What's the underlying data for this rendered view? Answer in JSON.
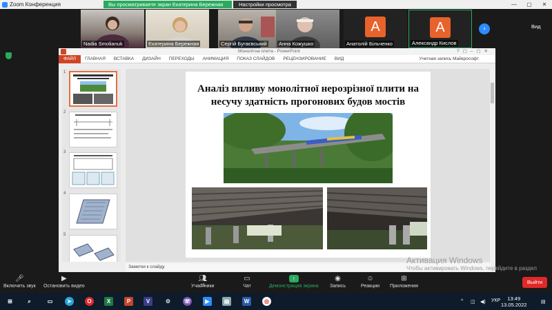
{
  "window": {
    "title": "Zoom Конференция"
  },
  "banner": {
    "sharing_text": "Вы просматриваете экран Екатерина Бережная",
    "view_options": "Настройки просмотра ⌄"
  },
  "participants": [
    {
      "name": "Nadia Smolianuk",
      "muted": true
    },
    {
      "name": "Екатерина Бережная",
      "muted": false
    },
    {
      "name": "Сергій Бугаєвський",
      "muted": true
    },
    {
      "name": "Анна Кожушко",
      "muted": true
    },
    {
      "name": "Анатолій Більченко",
      "muted": false,
      "initial": "A"
    },
    {
      "name": "Александр Кислов",
      "muted": false,
      "initial": "A"
    }
  ],
  "gallery": {
    "view_label": "Вид"
  },
  "powerpoint": {
    "doc_title": "Монолітна плита - PowerPoint",
    "account": "Учетная запись Майкрософт",
    "tabs": [
      "ФАЙЛ",
      "ГЛАВНАЯ",
      "ВСТАВКА",
      "ДИЗАЙН",
      "ПЕРЕХОДЫ",
      "АНИМАЦИЯ",
      "ПОКАЗ СЛАЙДОВ",
      "РЕЦЕНЗИРОВАНИЕ",
      "ВИД"
    ],
    "thumb_numbers": [
      "1",
      "2",
      "3",
      "4",
      "5"
    ],
    "slide_title": "Аналіз впливу монолітної нерозрізної плити на несучу здатність прогонових будов мостів",
    "notes_placeholder": "Заметки к слайду"
  },
  "watermark": {
    "line1": "Активация Windows",
    "line2": "Чтобы активировать Windows, перейдите в раздел \"Параметры\"."
  },
  "toolbar": {
    "unmute": "Включить звук",
    "stop_video": "Остановить видео",
    "participants": "Участники",
    "participants_count": "15",
    "chat": "Чат",
    "share": "Демонстрация экрана",
    "record": "Запись",
    "reactions": "Реакции",
    "apps": "Приложения",
    "leave": "Выйти"
  },
  "taskbar": {
    "lang": "УКР",
    "time": "13:49",
    "date": "13.05.2022"
  },
  "colors": {
    "zoom_blue": "#2d8cff",
    "share_green": "#2aaa5f",
    "leave_red": "#e02828",
    "avatar_orange": "#e8632c",
    "ppt_red": "#d04526"
  }
}
